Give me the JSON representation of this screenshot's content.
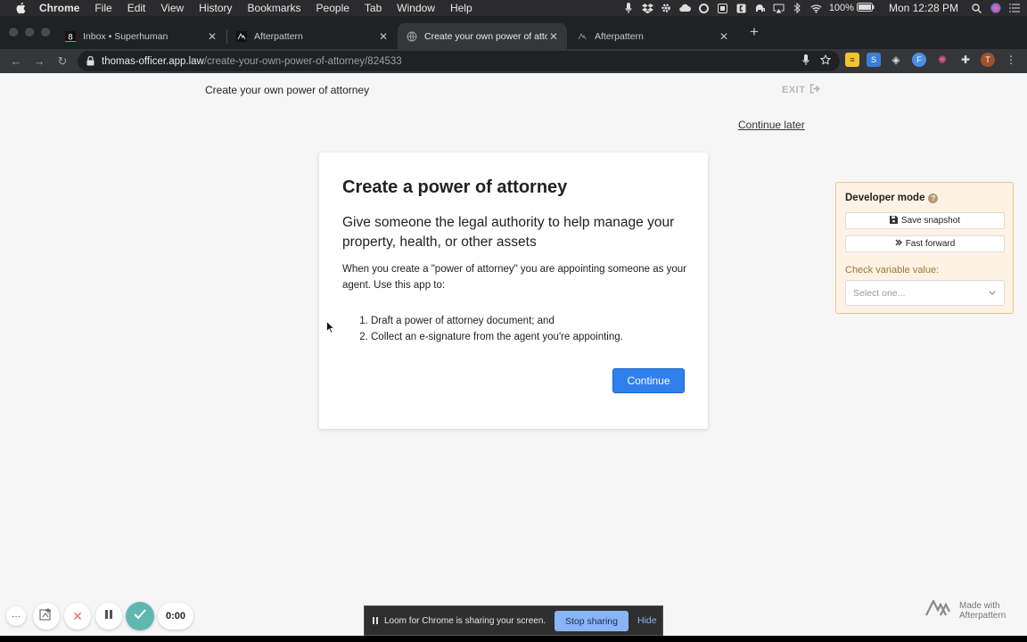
{
  "menubar": {
    "app": "Chrome",
    "items": [
      "File",
      "Edit",
      "View",
      "History",
      "Bookmarks",
      "People",
      "Tab",
      "Window",
      "Help"
    ],
    "battery": "100%",
    "clock": "Mon 12:28 PM"
  },
  "tabs": [
    {
      "label": "Inbox • Superhuman",
      "favicon": "superhuman-icon"
    },
    {
      "label": "Afterpattern",
      "favicon": "afterpattern-icon"
    },
    {
      "label": "Create your own power of attorn",
      "favicon": "globe-icon"
    },
    {
      "label": "Afterpattern",
      "favicon": "afterpattern-icon"
    }
  ],
  "address": {
    "host": "thomas-officer.app.law",
    "path": "/create-your-own-power-of-attorney/824533"
  },
  "page": {
    "title": "Create your own power of attorney",
    "exit_label": "EXIT",
    "continue_later": "Continue later"
  },
  "card": {
    "heading": "Create a power of attorney",
    "subheading": "Give someone the legal authority to help manage your property, health, or other assets",
    "body": "When you create a \"power of attorney\" you are appointing someone as your agent. Use this app to:",
    "list": [
      "Draft a power of attorney document; and",
      "Collect an e-signature from the agent you're appointing."
    ],
    "continue_button": "Continue"
  },
  "developer": {
    "title": "Developer mode",
    "save_snapshot": "Save snapshot",
    "fast_forward": "Fast forward",
    "check_label": "Check variable value:",
    "select_placeholder": "Select one..."
  },
  "loom": {
    "timer": "0:00",
    "share_text": "Loom for Chrome is sharing your screen.",
    "stop_sharing": "Stop sharing",
    "hide": "Hide"
  },
  "footer": {
    "made_with_line1": "Made with",
    "made_with_line2": "Afterpattern"
  },
  "colors": {
    "primary_button": "#2f80ed",
    "dev_bg": "#fdf2e4",
    "dev_border": "#efc58d",
    "loom_check": "#5fb8b0"
  }
}
